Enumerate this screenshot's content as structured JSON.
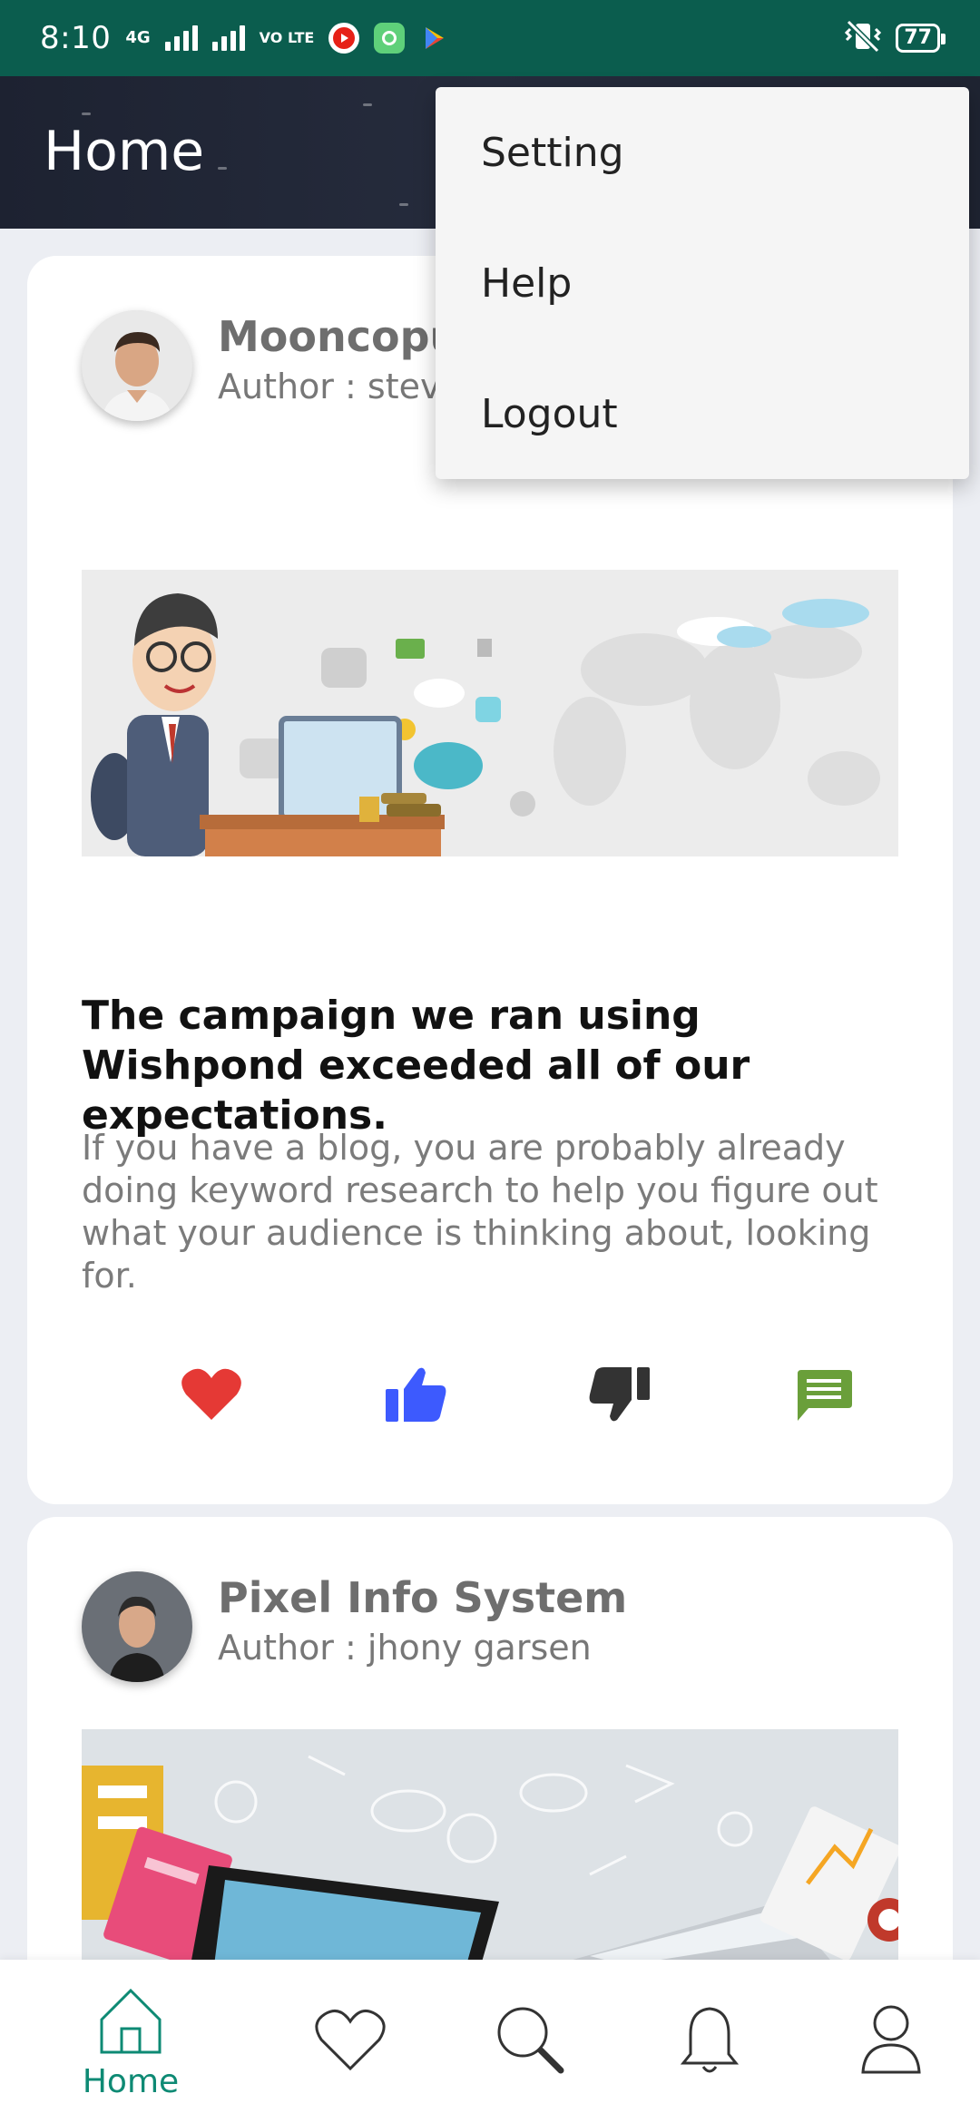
{
  "status_bar": {
    "time": "8:10",
    "network": "4G",
    "volte": "VO LTE",
    "battery": "77"
  },
  "app_bar": {
    "title": "Home"
  },
  "menu": {
    "items": [
      "Setting",
      "Help",
      "Logout"
    ]
  },
  "posts": [
    {
      "name": "Mooncopu",
      "author": "Author : steve",
      "headline": "The campaign we ran using Wishpond exceeded all of our expectations.",
      "excerpt": "If you have a blog, you are probably already doing keyword research to help you figure out what your audience is thinking about,  looking for.",
      "actions": [
        "heart-icon",
        "thumbs-up-icon",
        "thumbs-down-icon",
        "comment-icon"
      ]
    },
    {
      "name": "Pixel Info System",
      "author": "Author : jhony garsen"
    }
  ],
  "bottom_nav": {
    "items": [
      {
        "icon": "home-icon",
        "label": "Home",
        "active": true
      },
      {
        "icon": "heart-icon",
        "label": "",
        "active": false
      },
      {
        "icon": "search-icon",
        "label": "",
        "active": false
      },
      {
        "icon": "bell-icon",
        "label": "",
        "active": false
      },
      {
        "icon": "profile-icon",
        "label": "",
        "active": false
      }
    ]
  },
  "colors": {
    "status_bar": "#0b5d4e",
    "app_bar": "#1f2432",
    "accent": "#0e8a74",
    "like": "#e53935",
    "thumbs_up": "#3d5afe",
    "thumbs_down": "#333333",
    "comment": "#6a9f3a"
  }
}
